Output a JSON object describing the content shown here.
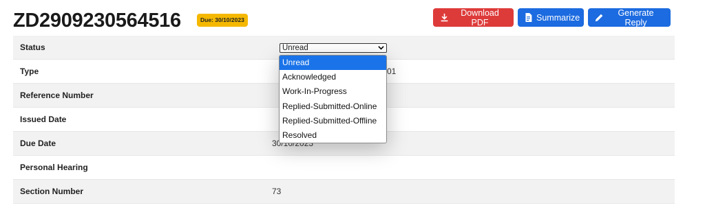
{
  "header": {
    "title": "ZD2909230564516",
    "due_badge": "Due: 30/10/2023",
    "buttons": {
      "download": "Download PDF",
      "summarize": "Summarize",
      "generate": "Generate Reply"
    }
  },
  "table": {
    "rows": [
      {
        "label": "Status",
        "value": ""
      },
      {
        "label": "Type",
        "value": ""
      },
      {
        "label": "Reference Number",
        "value": ""
      },
      {
        "label": "Issued Date",
        "value": ""
      },
      {
        "label": "Due Date",
        "value": "30/10/2023"
      },
      {
        "label": "Personal Hearing",
        "value": ""
      },
      {
        "label": "Section Number",
        "value": "73"
      }
    ]
  },
  "status_select": {
    "selected": "Unread",
    "options": [
      "Unread",
      "Acknowledged",
      "Work-In-Progress",
      "Replied-Submitted-Online",
      "Replied-Submitted-Offline",
      "Resolved"
    ]
  },
  "type_value_partial": "01",
  "colors": {
    "accent_blue": "#1c6be0",
    "danger_red": "#dd3b3a",
    "badge_yellow": "#f5b800",
    "selected_option": "#1a73e8"
  }
}
